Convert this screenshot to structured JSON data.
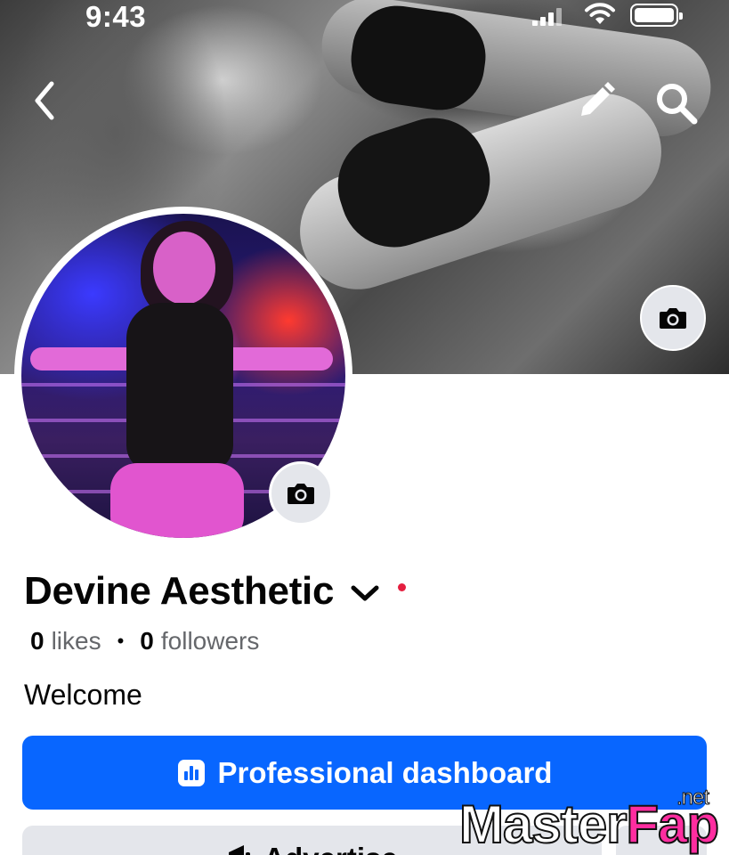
{
  "status_bar": {
    "time": "9:43"
  },
  "header": {
    "back_icon": "chevron-left-icon",
    "edit_icon": "pencil-icon",
    "search_icon": "search-icon"
  },
  "cover": {
    "camera_icon": "camera-icon"
  },
  "profile": {
    "camera_icon": "camera-icon",
    "name": "Devine Aesthetic",
    "likes_count": "0",
    "likes_label": "likes",
    "separator": "•",
    "followers_count": "0",
    "followers_label": "followers",
    "bio": "Welcome"
  },
  "actions": {
    "primary_label": "Professional dashboard",
    "secondary_label": "Advertise"
  },
  "watermark": {
    "part1": "Master",
    "part2": "Fap",
    "suffix": ".net"
  },
  "colors": {
    "accent": "#0866ff",
    "dot": "#e41e3f",
    "secondary_bg": "#e4e6eb"
  }
}
